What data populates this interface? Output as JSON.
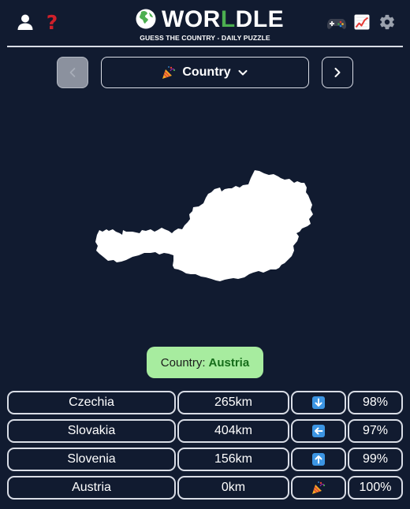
{
  "header": {
    "logo_prefix": "WOR",
    "logo_highlight": "L",
    "logo_suffix": "DLE",
    "subtitle": "GUESS THE COUNTRY - DAILY PUZZLE",
    "icons": [
      "user-icon",
      "help-icon",
      "controller-icon",
      "stats-icon",
      "gear-icon"
    ],
    "help_glyph": "?"
  },
  "nav": {
    "mode_label": "Country",
    "prev_disabled": true
  },
  "result": {
    "label": "Country:",
    "answer": "Austria"
  },
  "guesses": [
    {
      "country": "Czechia",
      "distance": "265km",
      "direction": "down",
      "proximity": "98%"
    },
    {
      "country": "Slovakia",
      "distance": "404km",
      "direction": "left",
      "proximity": "97%"
    },
    {
      "country": "Slovenia",
      "distance": "156km",
      "direction": "up",
      "proximity": "99%"
    },
    {
      "country": "Austria",
      "distance": "0km",
      "direction": "correct",
      "proximity": "100%"
    }
  ],
  "colors": {
    "background": "#111b30",
    "accent_green": "#4caf50",
    "result_bg": "#a7ec9f",
    "arrow_blue": "#3c95e3",
    "help_red": "#d0202a"
  }
}
